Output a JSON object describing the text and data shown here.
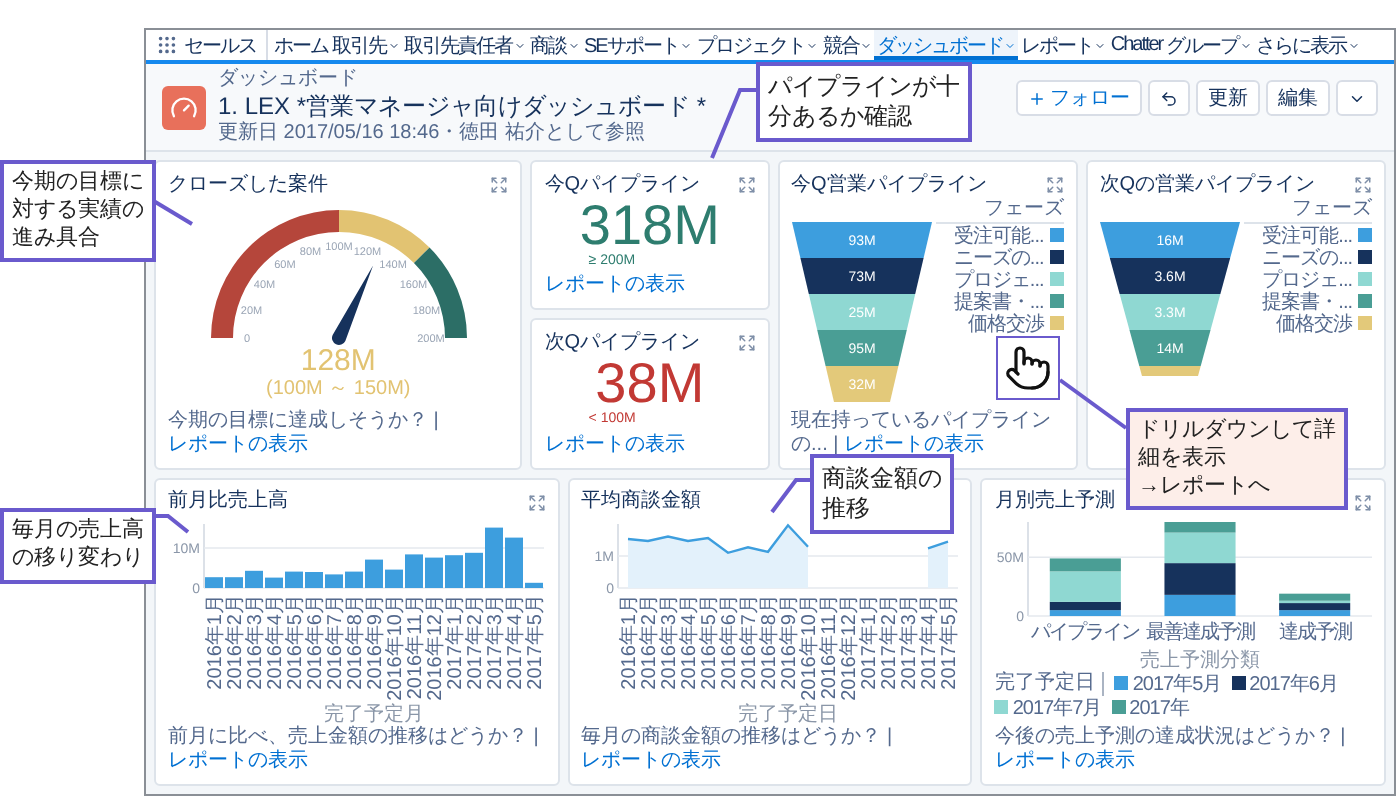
{
  "nav": {
    "app_name": "セールス",
    "items": [
      {
        "label": "ホーム",
        "dropdown": false,
        "selected": false
      },
      {
        "label": "取引先",
        "dropdown": true,
        "selected": false
      },
      {
        "label": "取引先責任者",
        "dropdown": true,
        "selected": false
      },
      {
        "label": "商談",
        "dropdown": true,
        "selected": false
      },
      {
        "label": "SEサポート",
        "dropdown": true,
        "selected": false
      },
      {
        "label": "プロジェクト",
        "dropdown": true,
        "selected": false
      },
      {
        "label": "競合",
        "dropdown": true,
        "selected": false
      },
      {
        "label": "ダッシュボード",
        "dropdown": true,
        "selected": true
      },
      {
        "label": "レポート",
        "dropdown": true,
        "selected": false
      },
      {
        "label": "Chatter",
        "dropdown": false,
        "selected": false
      },
      {
        "label": "グループ",
        "dropdown": true,
        "selected": false
      },
      {
        "label": "さらに表示",
        "dropdown": true,
        "selected": false
      }
    ]
  },
  "header": {
    "object_type": "ダッシュボード",
    "title": "1. LEX *営業マネージャ向けダッシュボード *",
    "meta": "更新日 2017/05/16 18:46・徳田 祐介として参照",
    "buttons": [
      {
        "kind": "follow",
        "label": "フォロー"
      },
      {
        "kind": "icon"
      },
      {
        "kind": "refresh",
        "label": "更新"
      },
      {
        "kind": "edit",
        "label": "編集"
      },
      {
        "kind": "menu"
      }
    ]
  },
  "gauge": {
    "title": "クローズした案件",
    "expand": true,
    "ticks": [
      "0",
      "20M",
      "40M",
      "60M",
      "80M",
      "100M",
      "120M",
      "140M",
      "160M",
      "180M",
      "200M"
    ],
    "level": 0.64,
    "value": "128M",
    "range": "(100M ～ 150M)",
    "footer": {
      "text": "今期の目標に達成しそうか？ |",
      "link": "レポートの表示"
    }
  },
  "kpis": [
    {
      "title": "今Qパイプライン",
      "expand": true,
      "value": "318M",
      "target": "≥ 200M",
      "color": "#2e7d6f",
      "link": "レポートの表示"
    },
    {
      "title": "次Qパイプライン",
      "expand": true,
      "value": "38M",
      "target": "< 100M",
      "color": "#c23934",
      "link": "レポートの表示"
    }
  ],
  "funnels": [
    {
      "title": "今Q営業パイプライン",
      "expand": true,
      "legend_title": "フェーズ",
      "legend": [
        {
          "label": "受注可能...",
          "color": "#3d9ede"
        },
        {
          "label": "ニーズの...",
          "color": "#16325c"
        },
        {
          "label": "プロジェ...",
          "color": "#8fd8d2"
        },
        {
          "label": "提案書・...",
          "color": "#4a9e95"
        },
        {
          "label": "価格交渉",
          "color": "#e3c97a"
        }
      ],
      "segments": [
        {
          "label": "93M",
          "color": "#3d9ede"
        },
        {
          "label": "73M",
          "color": "#16325c"
        },
        {
          "label": "25M",
          "color": "#8fd8d2"
        },
        {
          "label": "95M",
          "color": "#4a9e95"
        },
        {
          "label": "32M",
          "color": "#e3c97a"
        }
      ],
      "footer": {
        "text": "現在持っているパイプラインの... |",
        "link": "レポートの表示"
      }
    },
    {
      "title": "次Qの営業パイプライン",
      "expand": true,
      "legend_title": "フェーズ",
      "legend": [
        {
          "label": "受注可能...",
          "color": "#3d9ede"
        },
        {
          "label": "ニーズの...",
          "color": "#16325c"
        },
        {
          "label": "プロジェ...",
          "color": "#8fd8d2"
        },
        {
          "label": "提案書・...",
          "color": "#4a9e95"
        },
        {
          "label": "価格交渉",
          "color": "#e3c97a"
        }
      ],
      "segments": [
        {
          "label": "16M",
          "color": "#3d9ede"
        },
        {
          "label": "3.6M",
          "color": "#16325c"
        },
        {
          "label": "3.3M",
          "color": "#8fd8d2"
        },
        {
          "label": "14M",
          "color": "#4a9e95"
        },
        {
          "color": "#e3c97a"
        }
      ]
    }
  ],
  "monthly_sales": {
    "title": "前月比売上高",
    "expand": true,
    "chart_data": {
      "type": "bar",
      "xlabel": "完了予定月",
      "categories": [
        "2016年1月",
        "2016年2月",
        "2016年3月",
        "2016年4月",
        "2016年5月",
        "2016年6月",
        "2016年7月",
        "2016年8月",
        "2016年9月",
        "2016年10月",
        "2016年11月",
        "2016年12月",
        "2017年1月",
        "2017年2月",
        "2017年3月",
        "2017年4月",
        "2017年5月"
      ],
      "values": [
        2.7,
        2.7,
        4.3,
        2.6,
        4.1,
        4.0,
        3.4,
        4.1,
        7.1,
        4.6,
        8.4,
        7.6,
        8.2,
        8.8,
        15.1,
        12.6,
        1.3
      ],
      "ylim": [
        0,
        16
      ],
      "yticks": [
        0,
        {
          "value": 10,
          "label": "10M"
        }
      ]
    },
    "footer": {
      "text": "前月に比べ、売上金額の推移はどうか？ |",
      "link": "レポートの表示"
    }
  },
  "average_deal": {
    "title": "平均商談金額",
    "expand": false,
    "chart_data": {
      "type": "area",
      "xlabel": "完了予定日",
      "categories": [
        "2016年1月",
        "2016年2月",
        "2016年3月",
        "2016年4月",
        "2016年5月",
        "2016年6月",
        "2016年7月",
        "2016年8月",
        "2016年9月",
        "2016年10月",
        "2016年11月",
        "2016年12月",
        "2017年1月",
        "2017年2月",
        "2017年3月",
        "2017年4月",
        "2017年5月"
      ],
      "values": [
        1.53,
        1.47,
        1.61,
        1.47,
        1.56,
        1.1,
        1.27,
        1.13,
        1.96,
        1.29,
        null,
        null,
        null,
        null,
        null,
        1.24,
        1.45
      ],
      "ylim": [
        0,
        2
      ],
      "yticks": [
        0,
        {
          "value": 1,
          "label": "1M"
        }
      ]
    },
    "footer": {
      "text": "毎月の商談金額の推移はどうか？ |",
      "link": "レポートの表示"
    }
  },
  "forecast": {
    "title": "月別売上予測",
    "expand": true,
    "chart_data": {
      "type": "bar",
      "stacked": true,
      "xlabel": "売上予測分類",
      "categories": [
        "パイプライン",
        "最善達成予測",
        "達成予測"
      ],
      "series": [
        {
          "name": "2017年5月",
          "color": "#3d9ede",
          "values": [
            5,
            18,
            5
          ]
        },
        {
          "name": "2017年6月",
          "color": "#16325c",
          "values": [
            7,
            27,
            6
          ]
        },
        {
          "name": "2017年7月",
          "color": "#8fd8d2",
          "values": [
            26,
            26,
            2
          ]
        },
        {
          "name": "2017年",
          "color": "#4a9e95",
          "values": [
            11,
            9,
            6
          ]
        }
      ],
      "ylim": [
        0,
        80
      ],
      "yticks": [
        0,
        {
          "value": 50,
          "label": "50M"
        }
      ]
    },
    "legend_title": "完了予定日",
    "footer": {
      "text": "今後の売上予測の達成状況はどうか？ |",
      "link": "レポートの表示"
    }
  },
  "annotations": [
    {
      "kind": "note",
      "lines": [
        "今期の目標に",
        "対する実績の",
        "進み具合"
      ]
    },
    {
      "kind": "note",
      "lines": [
        "パイプラインが十",
        "分あるか確認"
      ]
    },
    {
      "kind": "note",
      "lines": [
        "毎月の売上高",
        "の移り変わり"
      ]
    },
    {
      "kind": "note",
      "lines": [
        "商談金額の",
        "推移"
      ]
    },
    {
      "kind": "highlight",
      "lines": [
        "ドリルダウンして詳",
        "細を表示",
        "→レポートへ"
      ]
    }
  ]
}
